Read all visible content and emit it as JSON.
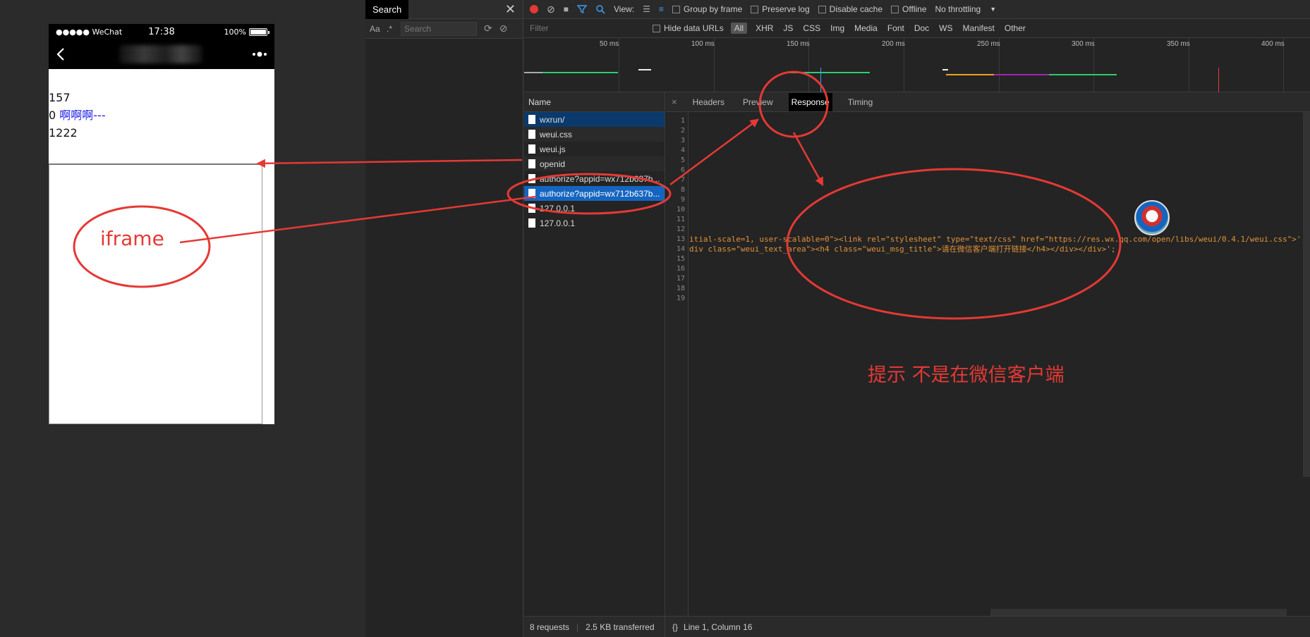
{
  "phone": {
    "carrier": "●●●●● WeChat",
    "time": "17:38",
    "battery": "100%",
    "content_lines": [
      "157",
      "0",
      "啊啊啊---",
      "1222"
    ]
  },
  "search_panel": {
    "tab_label": "Search",
    "aa_label": "Aa",
    "regex_label": ".*",
    "search_placeholder": "Search"
  },
  "toolbar": {
    "view_label": "View:",
    "group_by_frame": "Group by frame",
    "preserve_log": "Preserve log",
    "disable_cache": "Disable cache",
    "offline": "Offline",
    "throttling": "No throttling"
  },
  "filter": {
    "placeholder": "Filter",
    "hide_data_urls": "Hide data URLs",
    "types": [
      "All",
      "XHR",
      "JS",
      "CSS",
      "Img",
      "Media",
      "Font",
      "Doc",
      "WS",
      "Manifest",
      "Other"
    ]
  },
  "timeline": {
    "ticks": [
      "50 ms",
      "100 ms",
      "150 ms",
      "200 ms",
      "250 ms",
      "300 ms",
      "350 ms",
      "400 ms"
    ]
  },
  "requests": {
    "header": "Name",
    "items": [
      "wxrun/",
      "weui.css",
      "weui.js",
      "openid",
      "authorize?appid=wx712b637b...",
      "authorize?appid=wx712b637b...",
      "127.0.0.1",
      "127.0.0.1"
    ]
  },
  "detail": {
    "close": "×",
    "tabs": [
      "Headers",
      "Preview",
      "Response",
      "Timing"
    ],
    "line_numbers": [
      "1",
      "2",
      "3",
      "4",
      "5",
      "6",
      "7",
      "8",
      "9",
      "10",
      "11",
      "12",
      "13",
      "14",
      "15",
      "16",
      "17",
      "18",
      "19"
    ],
    "line13": "itial-scale=1, user-scalable=0\"><link rel=\"stylesheet\" type=\"text/css\" href=\"https://res.wx.qq.com/open/libs/weui/0.4.1/weui.css\">';",
    "line14": "div class=\"weui_text_area\"><h4 class=\"weui_msg_title\">请在微信客户端打开链接</h4></div></div>';"
  },
  "status": {
    "requests": "8 requests",
    "transferred": "2.5 KB transferred",
    "braces": "{}",
    "position": "Line 1, Column 16"
  },
  "annotations": {
    "iframe_label": "iframe",
    "hint": "提示 不是在微信客户端"
  },
  "colors": {
    "accent": "#e53935",
    "selected": "#1565c0",
    "code": "#e0913a"
  }
}
